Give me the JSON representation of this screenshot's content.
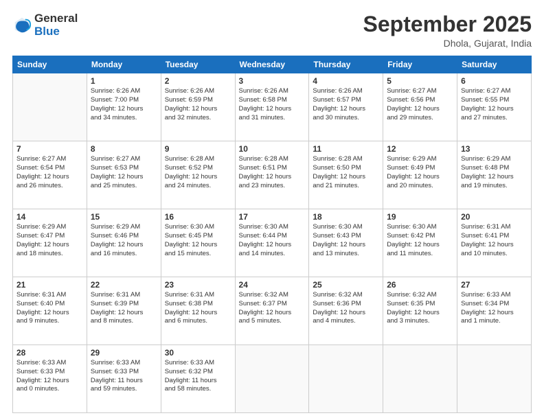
{
  "header": {
    "logo": {
      "general": "General",
      "blue": "Blue"
    },
    "title": "September 2025",
    "location": "Dhola, Gujarat, India"
  },
  "days_of_week": [
    "Sunday",
    "Monday",
    "Tuesday",
    "Wednesday",
    "Thursday",
    "Friday",
    "Saturday"
  ],
  "weeks": [
    [
      {
        "day": "",
        "info": ""
      },
      {
        "day": "1",
        "info": "Sunrise: 6:26 AM\nSunset: 7:00 PM\nDaylight: 12 hours\nand 34 minutes."
      },
      {
        "day": "2",
        "info": "Sunrise: 6:26 AM\nSunset: 6:59 PM\nDaylight: 12 hours\nand 32 minutes."
      },
      {
        "day": "3",
        "info": "Sunrise: 6:26 AM\nSunset: 6:58 PM\nDaylight: 12 hours\nand 31 minutes."
      },
      {
        "day": "4",
        "info": "Sunrise: 6:26 AM\nSunset: 6:57 PM\nDaylight: 12 hours\nand 30 minutes."
      },
      {
        "day": "5",
        "info": "Sunrise: 6:27 AM\nSunset: 6:56 PM\nDaylight: 12 hours\nand 29 minutes."
      },
      {
        "day": "6",
        "info": "Sunrise: 6:27 AM\nSunset: 6:55 PM\nDaylight: 12 hours\nand 27 minutes."
      }
    ],
    [
      {
        "day": "7",
        "info": "Sunrise: 6:27 AM\nSunset: 6:54 PM\nDaylight: 12 hours\nand 26 minutes."
      },
      {
        "day": "8",
        "info": "Sunrise: 6:27 AM\nSunset: 6:53 PM\nDaylight: 12 hours\nand 25 minutes."
      },
      {
        "day": "9",
        "info": "Sunrise: 6:28 AM\nSunset: 6:52 PM\nDaylight: 12 hours\nand 24 minutes."
      },
      {
        "day": "10",
        "info": "Sunrise: 6:28 AM\nSunset: 6:51 PM\nDaylight: 12 hours\nand 23 minutes."
      },
      {
        "day": "11",
        "info": "Sunrise: 6:28 AM\nSunset: 6:50 PM\nDaylight: 12 hours\nand 21 minutes."
      },
      {
        "day": "12",
        "info": "Sunrise: 6:29 AM\nSunset: 6:49 PM\nDaylight: 12 hours\nand 20 minutes."
      },
      {
        "day": "13",
        "info": "Sunrise: 6:29 AM\nSunset: 6:48 PM\nDaylight: 12 hours\nand 19 minutes."
      }
    ],
    [
      {
        "day": "14",
        "info": "Sunrise: 6:29 AM\nSunset: 6:47 PM\nDaylight: 12 hours\nand 18 minutes."
      },
      {
        "day": "15",
        "info": "Sunrise: 6:29 AM\nSunset: 6:46 PM\nDaylight: 12 hours\nand 16 minutes."
      },
      {
        "day": "16",
        "info": "Sunrise: 6:30 AM\nSunset: 6:45 PM\nDaylight: 12 hours\nand 15 minutes."
      },
      {
        "day": "17",
        "info": "Sunrise: 6:30 AM\nSunset: 6:44 PM\nDaylight: 12 hours\nand 14 minutes."
      },
      {
        "day": "18",
        "info": "Sunrise: 6:30 AM\nSunset: 6:43 PM\nDaylight: 12 hours\nand 13 minutes."
      },
      {
        "day": "19",
        "info": "Sunrise: 6:30 AM\nSunset: 6:42 PM\nDaylight: 12 hours\nand 11 minutes."
      },
      {
        "day": "20",
        "info": "Sunrise: 6:31 AM\nSunset: 6:41 PM\nDaylight: 12 hours\nand 10 minutes."
      }
    ],
    [
      {
        "day": "21",
        "info": "Sunrise: 6:31 AM\nSunset: 6:40 PM\nDaylight: 12 hours\nand 9 minutes."
      },
      {
        "day": "22",
        "info": "Sunrise: 6:31 AM\nSunset: 6:39 PM\nDaylight: 12 hours\nand 8 minutes."
      },
      {
        "day": "23",
        "info": "Sunrise: 6:31 AM\nSunset: 6:38 PM\nDaylight: 12 hours\nand 6 minutes."
      },
      {
        "day": "24",
        "info": "Sunrise: 6:32 AM\nSunset: 6:37 PM\nDaylight: 12 hours\nand 5 minutes."
      },
      {
        "day": "25",
        "info": "Sunrise: 6:32 AM\nSunset: 6:36 PM\nDaylight: 12 hours\nand 4 minutes."
      },
      {
        "day": "26",
        "info": "Sunrise: 6:32 AM\nSunset: 6:35 PM\nDaylight: 12 hours\nand 3 minutes."
      },
      {
        "day": "27",
        "info": "Sunrise: 6:33 AM\nSunset: 6:34 PM\nDaylight: 12 hours\nand 1 minute."
      }
    ],
    [
      {
        "day": "28",
        "info": "Sunrise: 6:33 AM\nSunset: 6:33 PM\nDaylight: 12 hours\nand 0 minutes."
      },
      {
        "day": "29",
        "info": "Sunrise: 6:33 AM\nSunset: 6:33 PM\nDaylight: 11 hours\nand 59 minutes."
      },
      {
        "day": "30",
        "info": "Sunrise: 6:33 AM\nSunset: 6:32 PM\nDaylight: 11 hours\nand 58 minutes."
      },
      {
        "day": "",
        "info": ""
      },
      {
        "day": "",
        "info": ""
      },
      {
        "day": "",
        "info": ""
      },
      {
        "day": "",
        "info": ""
      }
    ]
  ]
}
